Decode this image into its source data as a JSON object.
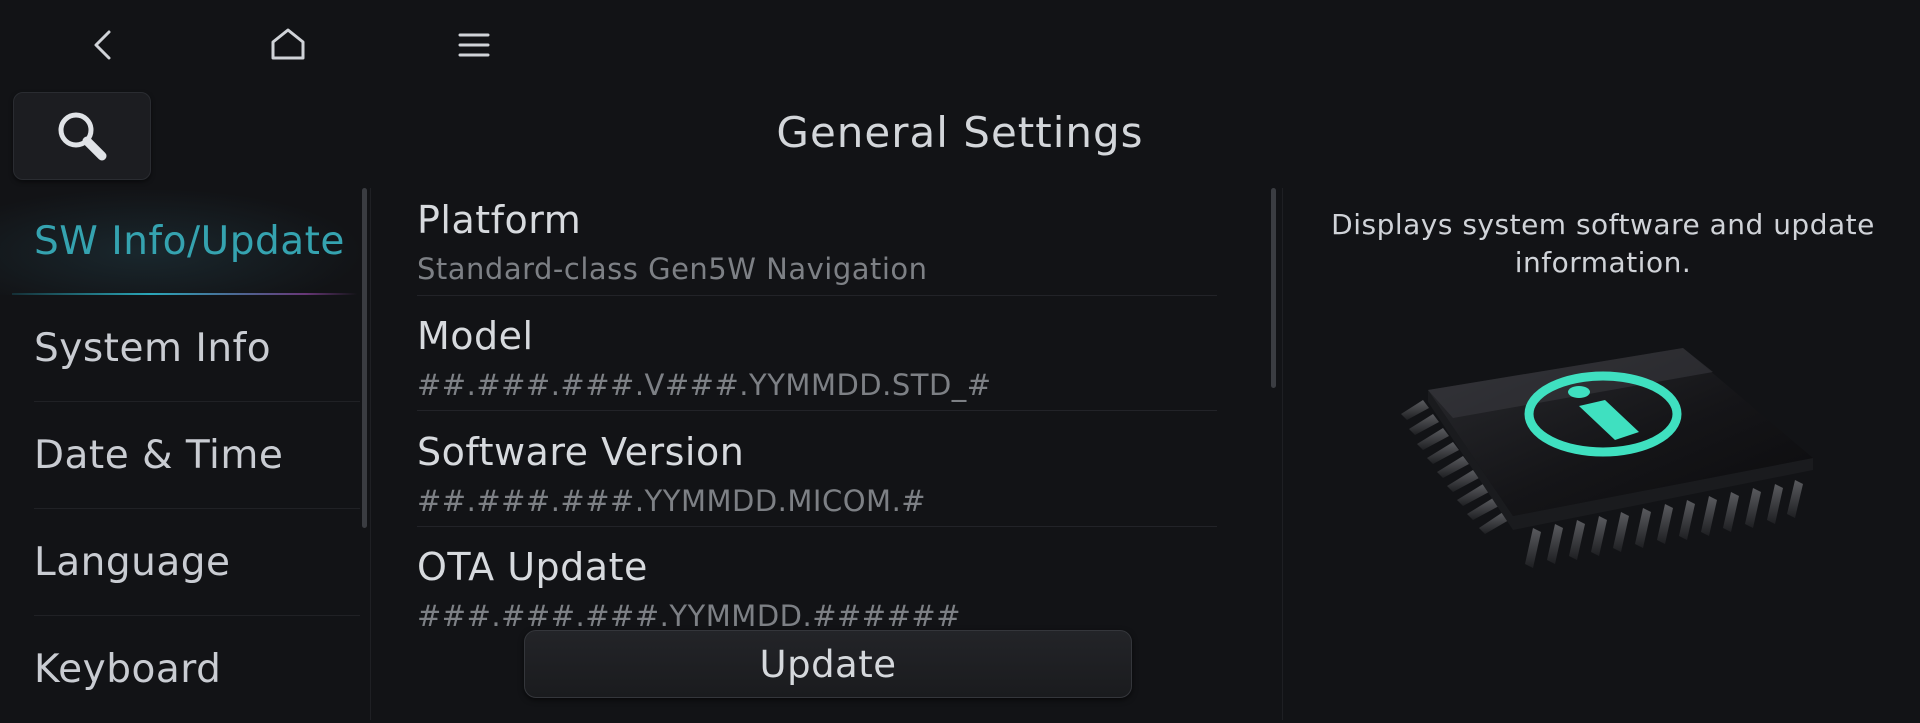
{
  "nav": {
    "back_icon": "chevron-left-icon",
    "home_icon": "home-icon",
    "menu_icon": "hamburger-menu-icon",
    "search_icon": "search-icon"
  },
  "header": {
    "title": "General Settings"
  },
  "sidebar": {
    "items": [
      {
        "label": "SW Info/Update",
        "active": true
      },
      {
        "label": "System Info",
        "active": false
      },
      {
        "label": "Date & Time",
        "active": false
      },
      {
        "label": "Language",
        "active": false
      },
      {
        "label": "Keyboard",
        "active": false
      }
    ]
  },
  "content": {
    "rows": [
      {
        "label": "Platform",
        "value": "Standard-class Gen5W Navigation"
      },
      {
        "label": "Model",
        "value": "##.###.###.V###.YYMMDD.STD_#"
      },
      {
        "label": "Software Version",
        "value": "##.###.###.YYMMDD.MICOM.#"
      },
      {
        "label": "OTA Update",
        "value": "###.###.###.YYMMDD.######"
      }
    ],
    "update_button": "Update"
  },
  "info_panel": {
    "description": "Displays system software and update information.",
    "illustration": "chip-info-icon"
  },
  "colors": {
    "accent": "#35a3b0",
    "chip_glow": "#3fe0c0",
    "background": "#121316"
  }
}
